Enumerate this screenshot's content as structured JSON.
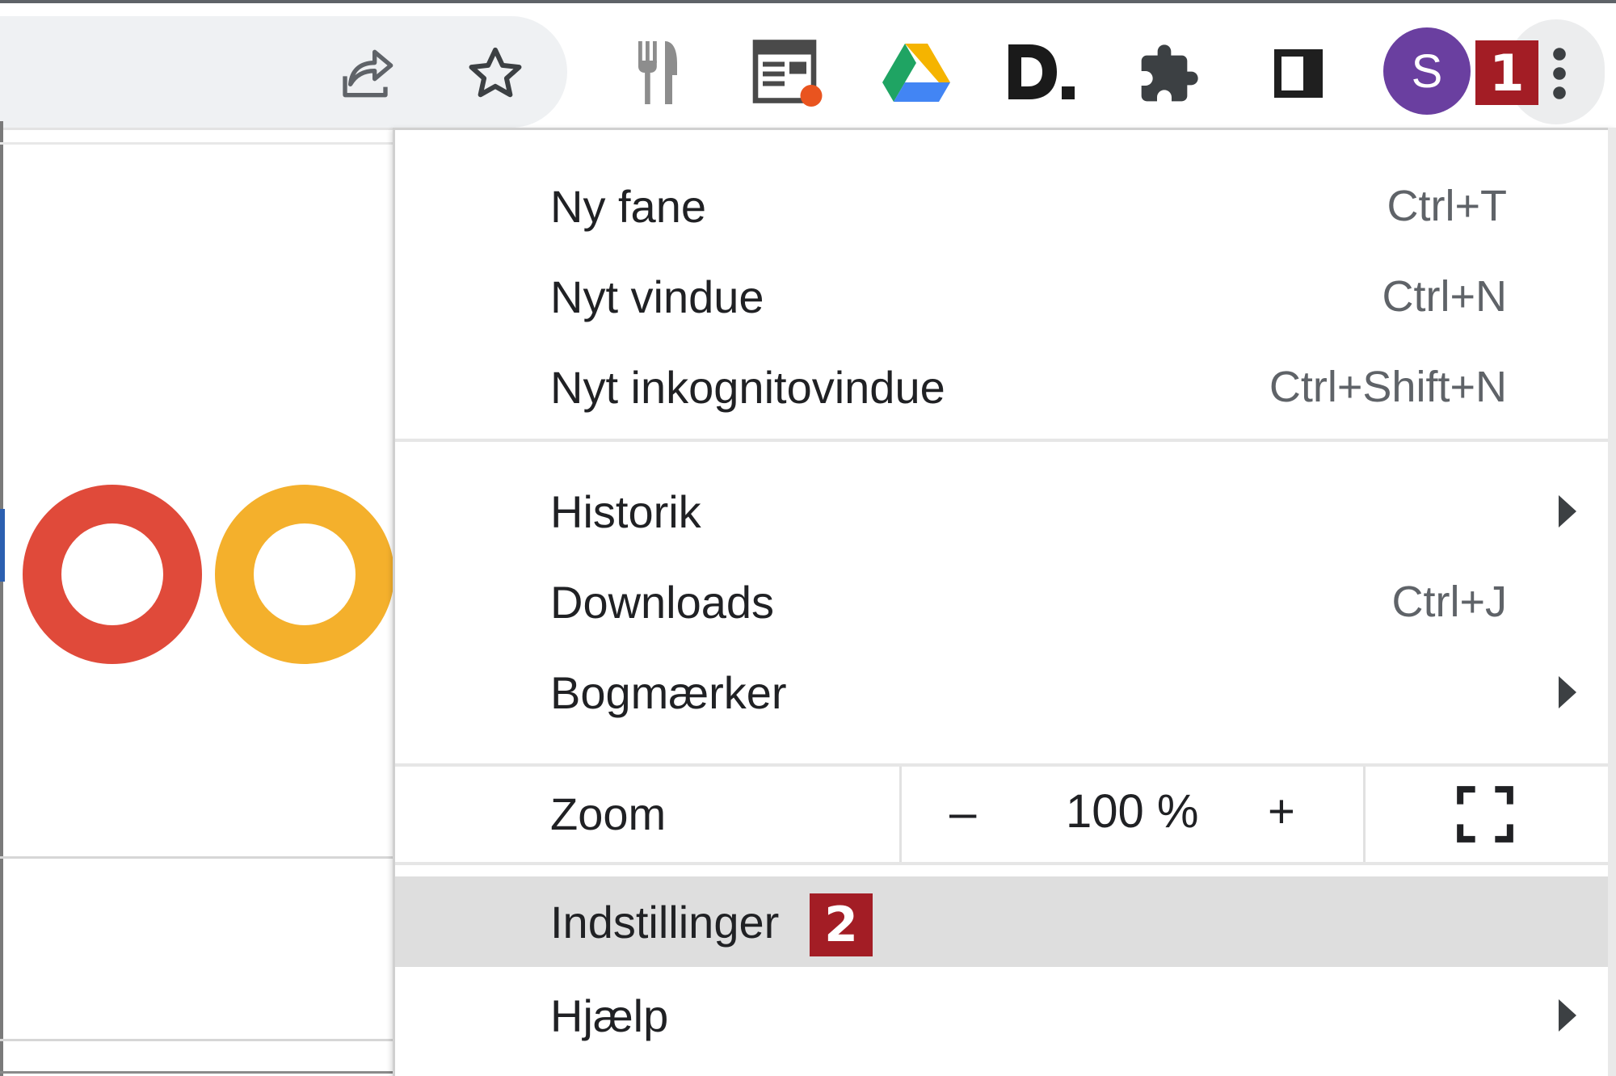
{
  "toolbar": {
    "icons": [
      "share-icon",
      "bookmark-star-icon",
      "fork-knife-extension-icon",
      "news-extension-icon",
      "google-drive-icon",
      "d-extension-icon",
      "extensions-puzzle-icon",
      "side-panel-icon",
      "profile-avatar",
      "more-vert-icon"
    ],
    "avatar_letter": "S",
    "avatar_color": "#6a3fa0",
    "callout_1": "1"
  },
  "menu": {
    "items": [
      {
        "label": "Ny fane",
        "shortcut": "Ctrl+T"
      },
      {
        "label": "Nyt vindue",
        "shortcut": "Ctrl+N"
      },
      {
        "label": "Nyt inkognitovindue",
        "shortcut": "Ctrl+Shift+N"
      },
      {
        "label": "Historik",
        "shortcut": ""
      },
      {
        "label": "Downloads",
        "shortcut": "Ctrl+J"
      },
      {
        "label": "Bogmærker",
        "shortcut": ""
      },
      {
        "label": "Indstillinger",
        "shortcut": ""
      },
      {
        "label": "Hjælp",
        "shortcut": ""
      }
    ],
    "zoom": {
      "label": "Zoom",
      "minus": "–",
      "value": "100 %",
      "plus": "+"
    },
    "callout_2": "2"
  },
  "colors": {
    "callout_badge": "#a31d25",
    "highlight": "#dedede",
    "logo_red": "#e04a3a",
    "logo_yellow": "#f4b02c"
  }
}
